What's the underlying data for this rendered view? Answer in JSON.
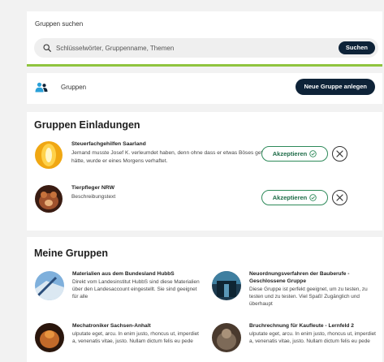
{
  "search": {
    "title": "Gruppen suchen",
    "placeholder": "Schlüsselwörter, Gruppenname, Themen",
    "button_label": "Suchen",
    "accent_color": "#8fc43f"
  },
  "groups_bar": {
    "label": "Gruppen",
    "icon": "users-icon",
    "new_group_label": "Neue Gruppe anlegen"
  },
  "invitations": {
    "title": "Gruppen Einladungen",
    "items": [
      {
        "name": "Steuerfachgehilfen Saarland",
        "description": "Jemand musste Josef K. verleumdet haben, denn ohne dass er etwas Böses getan hätte, wurde er eines Morgens verhaftet.",
        "accept_label": "Akzeptieren",
        "accept_icon": "check-circle-icon",
        "decline_icon": "close-circle-icon"
      },
      {
        "name": "Tierpfleger NRW",
        "description": "Beschreibungstext",
        "accept_label": "Akzeptieren",
        "accept_icon": "check-circle-icon",
        "decline_icon": "close-circle-icon"
      }
    ]
  },
  "my_groups": {
    "title": "Meine Gruppen",
    "items": [
      {
        "name": "Materialien aus dem Bundesland HubbS",
        "description": "Direkt vom Landesinstitut HubbS sind diese Materialien über den Landesaccount eingestellt. Sie sind geeignet für alle"
      },
      {
        "name": "Neuordnungsverfahren der Bauberufe - Geschlossene Gruppe",
        "description": "Diese Gruppe ist perfekt geeignet, um zu testen, zu testen und zu testen. Viel Spaß! Zugänglich und überhaupt"
      },
      {
        "name": "Mechatroniker Sachsen-Anhalt",
        "description": "ulputate eget, arcu. In enim justo, rhoncus ut, imperdiet a, venenatis vitae, justo. Nullam dictum felis eu pede"
      },
      {
        "name": "Bruchrechnung für Kaufleute - Lernfeld 2",
        "description": "ulputate eget, arcu. In enim justo, rhoncus ut, imperdiet a, venenatis vitae, justo. Nullam dictum felis eu pede"
      }
    ]
  }
}
